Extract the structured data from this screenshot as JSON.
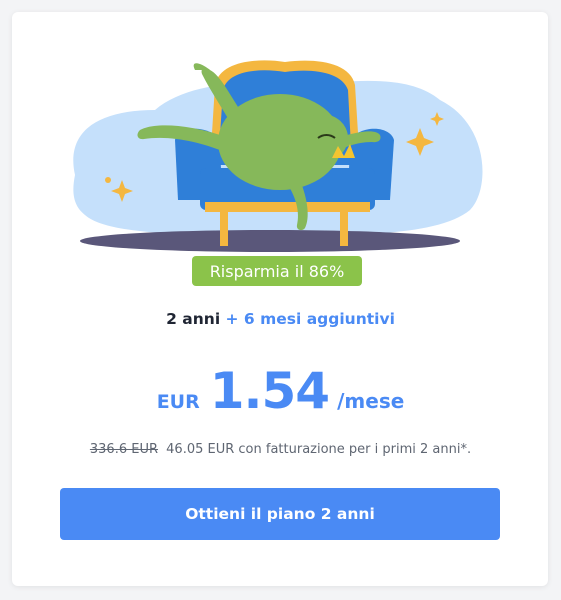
{
  "colors": {
    "accent": "#4a8af4",
    "badge": "#8bc34a",
    "text_dark": "#1f2533",
    "text_muted": "#5f6672"
  },
  "illustration": {
    "icon": "frog-lounging-on-armchair-illustration"
  },
  "offer": {
    "savings_badge": "Risparmia il 86%",
    "plan_duration": "2 anni",
    "plan_bonus": "+ 6 mesi aggiuntivi",
    "price_currency": "EUR",
    "price_amount": "1.54",
    "price_period": "/mese",
    "billing_old_price": "336.6 EUR",
    "billing_text": "46.05 EUR con fatturazione per i primi 2 anni*.",
    "cta_label": "Ottieni il piano 2 anni"
  }
}
